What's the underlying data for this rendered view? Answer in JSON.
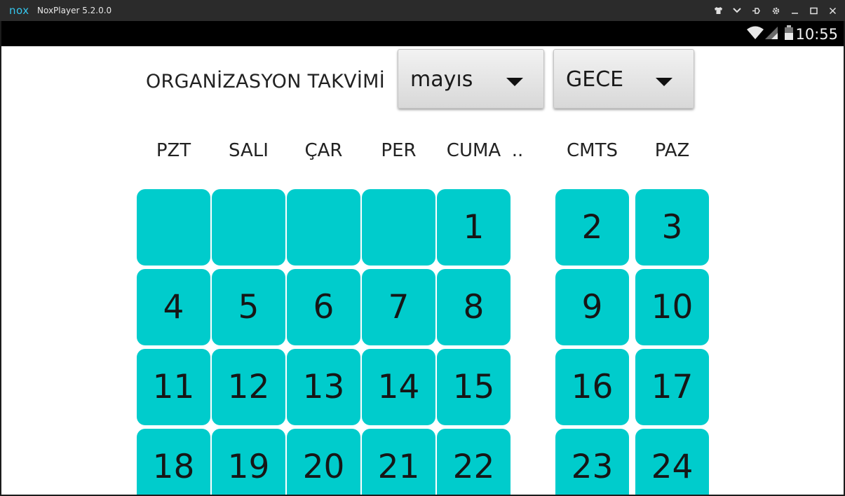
{
  "window": {
    "title": "NoxPlayer 5.2.0.0",
    "logo_text": "nox",
    "controls": [
      "shirt-icon",
      "chevron-down-icon",
      "pin-icon",
      "gear-icon",
      "minimize-icon",
      "maximize-icon",
      "close-icon"
    ]
  },
  "statusbar": {
    "time": "10:55"
  },
  "app": {
    "heading": "ORGANİZASYON TAKVİMİ",
    "month_select": {
      "value": "mayıs"
    },
    "shift_select": {
      "value": "GECE"
    },
    "day_headers": [
      "PZT",
      "SALI",
      "ÇAR",
      "PER",
      "CUMA",
      "..",
      "CMTS",
      "PAZ"
    ],
    "weeks": [
      [
        "",
        "",
        "",
        "",
        "1",
        "2",
        "3"
      ],
      [
        "4",
        "5",
        "6",
        "7",
        "8",
        "9",
        "10"
      ],
      [
        "11",
        "12",
        "13",
        "14",
        "15",
        "16",
        "17"
      ],
      [
        "18",
        "19",
        "20",
        "21",
        "22",
        "23",
        "24"
      ]
    ],
    "cell_color": "#00cccc"
  }
}
